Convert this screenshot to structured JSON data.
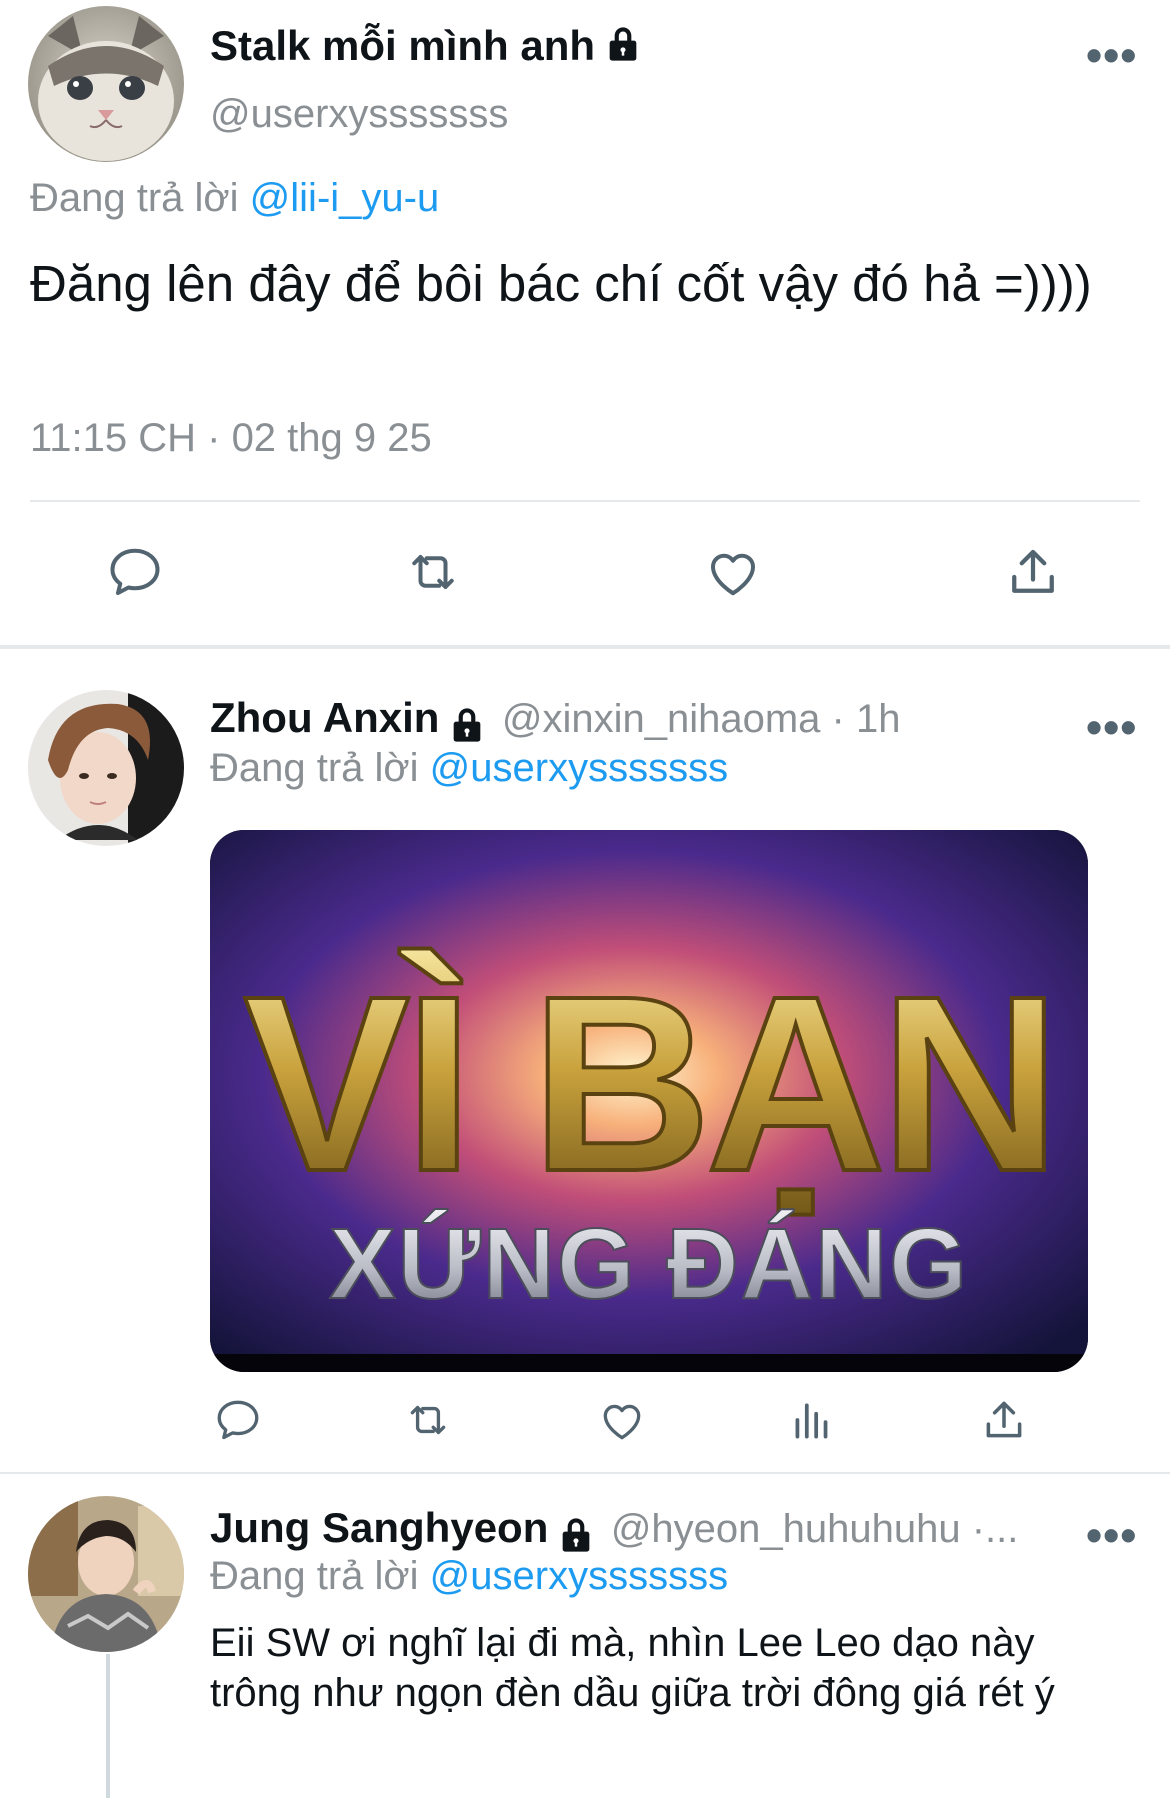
{
  "main_tweet": {
    "display_name": "Stalk mỗi mình anh",
    "handle": "@userxysssssss",
    "reply_prefix": "Đang trả lời",
    "reply_to": "@lii-i_yu-u",
    "text": "Đăng lên đây để bôi bác chí cốt vậy đó hả =))))",
    "timestamp": "11:15 CH · 02 thg 9 25",
    "more_label": "•••",
    "actions": [
      "reply-icon",
      "retweet-icon",
      "like-icon",
      "share-icon"
    ]
  },
  "replies": [
    {
      "display_name": "Zhou Anxin",
      "handle": "@xinxin_nihaoma · 1h",
      "reply_prefix": "Đang trả lời",
      "reply_to": "@userxysssssss",
      "more_label": "•••",
      "image": {
        "line1": "VÌ BẠN",
        "line2": "XỨNG ĐÁNG"
      },
      "actions": [
        "reply-icon",
        "retweet-icon",
        "like-icon",
        "views-icon",
        "share-icon"
      ]
    },
    {
      "display_name": "Jung Sanghyeon",
      "handle": "@hyeon_huhuhuhu ·...",
      "reply_prefix": "Đang trả lời",
      "reply_to": "@userxysssssss",
      "more_label": "•••",
      "text": "Eii SW ơi nghĩ lại đi mà, nhìn Lee Leo dạo này trông như ngọn đèn dầu giữa trời đông giá rét ý"
    }
  ],
  "colors": {
    "link": "#1d9bf0",
    "muted": "#8a8f94",
    "icon": "#536471",
    "divider": "#e6e9ec"
  }
}
